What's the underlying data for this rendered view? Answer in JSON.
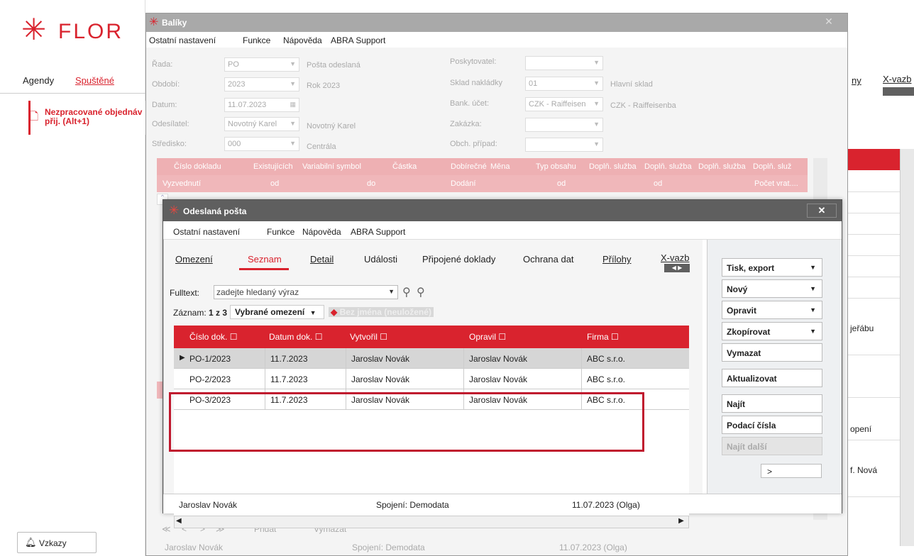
{
  "left": {
    "logo_text": "FLOR",
    "tabs": {
      "agendy": "Agendy",
      "spustene": "Spuštěné"
    },
    "item_line1": "Nezpracované objednáv",
    "item_line2": "přij. (Alt+1)",
    "vzkazy": "Vzkazy"
  },
  "bg": {
    "tab1": "ny",
    "tab2": "X-vazb",
    "texts": [
      "jeřábu",
      "opení",
      "f. Nová"
    ]
  },
  "baliky": {
    "title": "Balíky",
    "menu": [
      "Ostatní nastavení",
      "Funkce",
      "Nápověda",
      "ABRA Support"
    ],
    "fields": {
      "rada_l": "Řada:",
      "rada_v": "PO",
      "rada_d": "Pošta odeslaná",
      "obdobi_l": "Období:",
      "obdobi_v": "2023",
      "obdobi_d": "Rok 2023",
      "datum_l": "Datum:",
      "datum_v": "11.07.2023",
      "odesilatel_l": "Odesílatel:",
      "odesilatel_v": "Novotný Karel",
      "odesilatel_d": "Novotný Karel",
      "stredisko_l": "Středisko:",
      "stredisko_v": "000",
      "stredisko_d": "Centrála",
      "poskytovatel_l": "Poskytovatel:",
      "sklad_l": "Sklad nakládky",
      "sklad_v": "01",
      "sklad_d": "Hlavní sklad",
      "bank_l": "Bank. účet:",
      "bank_v": "CZK - Raiffeisen",
      "bank_d": "CZK - Raiffeisenba",
      "zakazka_l": "Zakázka:",
      "obch_l": "Obch. případ:"
    },
    "head_cols": [
      "Číslo dokladu",
      "Existujících",
      "Variabilní symbol",
      "Částka",
      "Dobírečné",
      "Měna",
      "Typ obsahu",
      "Doplň. služba",
      "Doplň. služba",
      "Doplň. služba",
      "Doplň. služ"
    ],
    "row_cols": [
      "Vyzvednutí",
      "od",
      "do",
      "Dodání",
      "od",
      "od",
      "Počet vrat...."
    ],
    "nav": [
      "≪",
      "<",
      ">",
      "≫",
      "Přidat",
      "Vymazat"
    ],
    "status": {
      "user": "Jaroslav Novák",
      "conn": "Spojení: Demodata",
      "date": "11.07.2023 (Olga)"
    }
  },
  "odeslana": {
    "title": "Odeslaná pošta",
    "close": "✕",
    "menu": [
      "Ostatní nastavení",
      "Funkce",
      "Nápověda",
      "ABRA Support"
    ],
    "tabs": [
      "Omezení",
      "Seznam",
      "Detail",
      "Události",
      "Připojené doklady",
      "Ochrana dat",
      "Přílohy"
    ],
    "xvazby": "X-vazb",
    "fulltext_label": "Fulltext:",
    "fulltext_placeholder": "zadejte hledaný výraz",
    "zaznam_label": "Záznam:",
    "zaznam_value": "1 z 3",
    "vybrane": "Vybrané omezení",
    "bez_jmena": "Bez jména (neuložené)",
    "columns": [
      "Číslo dok. ☐",
      "Datum dok. ☐",
      "Vytvořil ☐",
      "Opravil ☐",
      "Firma ☐"
    ],
    "rows": [
      {
        "cislo": "PO-1/2023",
        "datum": "11.7.2023",
        "vytvoril": "Jaroslav Novák",
        "opravil": "Jaroslav Novák",
        "firma": "ABC s.r.o."
      },
      {
        "cislo": "PO-2/2023",
        "datum": "11.7.2023",
        "vytvoril": "Jaroslav Novák",
        "opravil": "Jaroslav Novák",
        "firma": "ABC s.r.o."
      },
      {
        "cislo": "PO-3/2023",
        "datum": "11.7.2023",
        "vytvoril": "Jaroslav Novák",
        "opravil": "Jaroslav Novák",
        "firma": "ABC s.r.o."
      }
    ],
    "buttons": [
      "Tisk, export",
      "Nový",
      "Opravit",
      "Zkopírovat",
      "Vymazat",
      "Aktualizovat",
      "Najít",
      "Podací čísla",
      "Najít další"
    ],
    "small_btn": ">",
    "status": {
      "user": "Jaroslav Novák",
      "conn": "Spojení: Demodata",
      "date": "11.07.2023 (Olga)"
    }
  }
}
